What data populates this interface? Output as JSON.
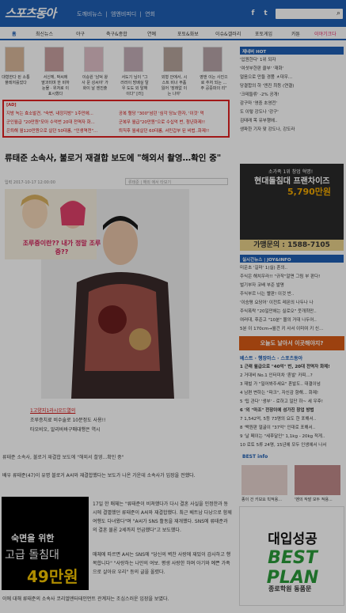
{
  "header": {
    "logo": "스포츠동아",
    "links": [
      "도깨비뉴스",
      "|",
      "엠엔비피디",
      "|",
      "연회"
    ],
    "search_placeholder": ""
  },
  "nav": {
    "items": [
      "홈",
      "최신뉴스",
      "야구",
      "축구&종합",
      "연예",
      "포토&화보",
      "이슈&갤러리",
      "포토게임",
      "카툰",
      "이야기크다"
    ]
  },
  "thumbs": [
    {
      "caption": "대형한다 된 소통 플레저를었다"
    },
    {
      "caption": "서신께, 박씨에 딸과미며 한 비하 눈물 · 위처로 이 표시했다"
    },
    {
      "caption": "이승원 '남덕 왕사 문 성씨야' 가 화이 날 엔진출"
    },
    {
      "caption": "서도기 님이 \"그러러이 방배실 탈 우 도도 외 탈해이다\" [러]"
    },
    {
      "caption": "외형 안에서, 시스트 비너 부품 잃어 '장래없 이는 나야'"
    },
    {
      "caption": "영앤 이는 사진으로 추처 되는 ... 주 공중파의 리\""
    }
  ],
  "adbox": {
    "tag": "[AD]",
    "rows": [
      "지방 녹는 효소발견, \"숙변, 내장지방\" 1주만에...",
      "공복 혈당 \"300\"넘던 '심각 당뇨'환자, '이것' 먹",
      "군인월급 \"20만원\"모아 수억번 20대 전역자 화...",
      "군복무 월급\"20만원\"으로 수십억 번, 청년화제!!",
      "은퇴해 월120만원으로 살던 50대롬, \"인생역전\"...",
      "퇴직후 월세살던 60대롬, 서민갑부 된 비법..화제!!"
    ]
  },
  "article": {
    "title": "류태준 소속사, 불로거 재결합 보도에 \"해외서 촬영…확인 중\"",
    "byline": "입력 2017-10-17 12:00:00",
    "share_text": "류태준 | 해외 에서 타보기",
    "cartoon_text": "조루증이란?? 내가 정말 조루증??",
    "ad_links": [
      "1고양지1라시오드열의",
      "조루증치료 비수술로 10분정도 사용!!",
      "타오비오, 알리바바구매대행은 역시"
    ],
    "photo_caption": "류태준 소속사, 불로거 재결합 보도에 \"해외서 촬영...확인 중\"",
    "paras": [
      "배우 류태준(47)이 유명 블로거 A씨와 재결합했다는 보도가 나온 가운데 소속사가 입장을 전했다.",
      "17일 한 매체는 \"류태준이 비쳐했다가 다시 결혼 사실을 인정한과 동시에 결별했던 류태준이 A씨와 재결합했다. 최근 베트남 다낭으로 함께 여행도 다녀왔다\"며 \"A씨가 SNS 활동을 재개했다. SNS에 류태준과의 결혼 물론 2세까지 언급했다\"고 보도했다.",
      "매체에 따르면 A씨는 SNS에 \"당신의 벽찬 사랑에 재밌이 감사하고 행복합니다\" \"사랑하는 나만의 여보. 평생 사랑한 하며 아기와 예쁜 가족으로 살아요 우리\" 등의 글을 올렸다.",
      "이에 대해 류태준의 소속사 코리엘엔터테인먼트 관계자는 조심스러운 입장을 보였다."
    ],
    "chimney_ad": {
      "l1": "숙면을 위한",
      "l2": "고급 돌침대",
      "l3": "49만원"
    }
  },
  "right": {
    "hot_title": "제네버 HOT",
    "hot_list": [
      "'입원한다' 1위 되자",
      "'여섯부한판 클부' '재화'",
      "얼음으로 만들 경품 ㅊ대우...",
      "당결합의 하 '엔진 최등 (연결)",
      "'크테들류' -2% 공개!",
      "감구마 '영중 초영전'",
      "도 이렇 강도나 '강구'",
      "김태래 목 유부행에..",
      "생파한 기자 맞 강도나, 강도라"
    ],
    "bed_ad": {
      "l1": "소가족 1위 창업 혁명!",
      "l2": "현대돌침대 프랜차이즈",
      "l3": "5,790만원",
      "l4": "가맹문의 : 1588-7105"
    },
    "realtime_title": "실시간뉴스 | JOY&INFO",
    "realtime_list": [
      "미운초 '길마' 1(실) 혼의..",
      "주식은 해치우라!! \"규작\"알면 그림 부 판다!",
      "벌기부자 코배 부준 발명",
      "주식부르 너는 빨판! 이것 반..",
      "'이승평 요당어' 이전트 레몬의 나두나 나",
      "주식폭락 \"20일만에는 실로오\" 웃개최만..",
      "여러대, 후준고 \"10분\" 몰의 거대 나두어..",
      "5분 이 170cm→월건 키 사서 이미여 키 신..."
    ],
    "orange_banner": "오늘도 날아서 이곳해야지?",
    "best_title": "베스트 · 행장마스 · 스포츠동아",
    "best_list": [
      "1 근래 월급으로 \"40억\" 번, 20대 전역자 화제!",
      "2 거대비 No.1 인터미차 '혼발' 카피...?",
      "3 재벌 가 \"밀어봐주세요\" 혼발도.. 대결이넘",
      "4 남편 변하는 \"파크\", 자신감 향해... 화제!",
      "5 '팁 관다' '생부' - 로하고 일단 하~ 세 우후!",
      "6 '외 \"마조\" 전장이에 성가진 창업 방법",
      "7 1,542억, 5등 73명의 요도 한 포해서..",
      "8 '백원판 얼굴이 \"37억\" 인대로 포해서..",
      "9 '날 페이는 \"세후달인\" 1,1kg - 20kg 적게..",
      "10 로토 5류 24명, 15년에 모두 인생에서 나서"
    ],
    "best_info": "BEST info",
    "best_caps": [
      "종이 건 키보요 빅적용...",
      "'벤의 작발 모두 적용..."
    ],
    "univ_ad": {
      "u1": "대입성공",
      "u2": "BEST PLAN",
      "u3": "종로학원  동품문"
    }
  }
}
